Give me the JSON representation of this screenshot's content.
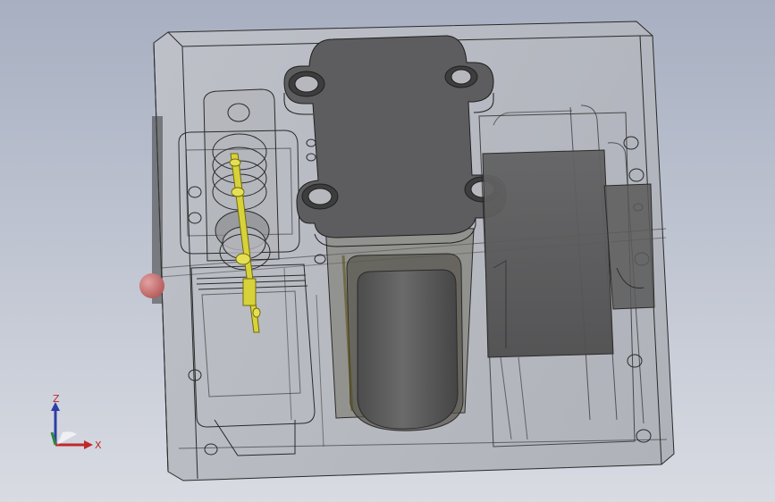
{
  "viewport": {
    "background_top": "#a7afc1",
    "background_bottom": "#d8dbe2"
  },
  "model": {
    "housing_color": "#b2b4bb",
    "edge_color": "#2a2a2a",
    "cover_plate_color": "#5d5d5f",
    "motor_color": "#5a5a5b",
    "cylinder_color": "#606061",
    "shaft_color": "#d8d23a",
    "marker_color": "#c87070"
  },
  "triad": {
    "z_label": "Z",
    "x_label": "X",
    "z_color": "#2d3ea8",
    "x_color": "#c0282a",
    "y_color": "#2f8a3a",
    "label_color": "#c0282a"
  }
}
